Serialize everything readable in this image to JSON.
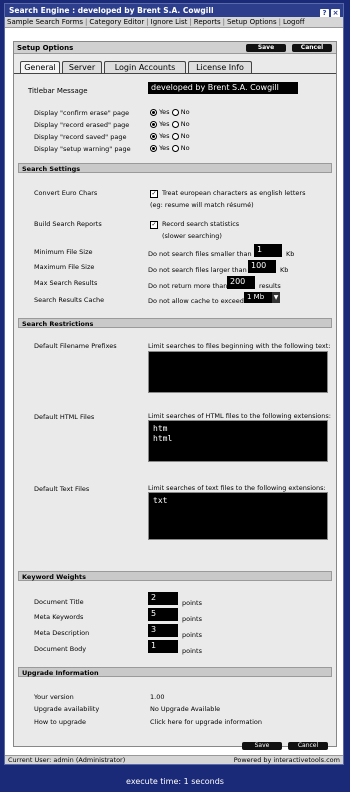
{
  "window": {
    "title": "Search Engine : developed by Brent S.A. Cowgill"
  },
  "menu": [
    "Sample Search Forms",
    "Category Editor",
    "Ignore List",
    "Reports",
    "Setup Options",
    "Logoff"
  ],
  "panel": {
    "title": "Setup Options",
    "save": "Save",
    "cancel": "Cancel"
  },
  "tabs": [
    "General",
    "Server",
    "Login Accounts",
    "License Info"
  ],
  "general": {
    "titlebar_label": "Titlebar Message",
    "titlebar_value": "developed by Brent S.A. Cowgill",
    "displays": [
      {
        "label": "Display \"confirm erase\" page",
        "value": "Yes"
      },
      {
        "label": "Display \"record erased\" page",
        "value": "Yes"
      },
      {
        "label": "Display \"record saved\" page",
        "value": "Yes"
      },
      {
        "label": "Display \"setup warning\" page",
        "value": "Yes"
      }
    ],
    "yes": "Yes",
    "no": "No"
  },
  "search_settings": {
    "heading": "Search Settings",
    "euro_label": "Convert Euro Chars",
    "euro_text1": "Treat european characters as english letters",
    "euro_text2": "(eg: resume will match résumé)",
    "build_label": "Build Search Reports",
    "build_text1": "Record search statistics",
    "build_text2": "(slower searching)",
    "min_label": "Minimum File Size",
    "min_text": "Do not search files smaller than",
    "min_value": "1",
    "min_unit": "Kb",
    "max_label": "Maximum File Size",
    "max_text": "Do not search files larger than",
    "max_value": "100",
    "max_unit": "Kb",
    "results_label": "Max Search Results",
    "results_text": "Do not return more than",
    "results_value": "200",
    "results_unit": "results",
    "cache_label": "Search Results Cache",
    "cache_text": "Do not allow cache to exceed",
    "cache_value": "1 Mb"
  },
  "search_restrictions": {
    "heading": "Search Restrictions",
    "prefix_label": "Default Filename Prefixes",
    "prefix_text": "Limit searches to files beginning with the following text:",
    "prefix_value": "",
    "html_label": "Default HTML Files",
    "html_text": "Limit searches of HTML files to the following extensions:",
    "html_value": "htm\nhtml",
    "text_label": "Default Text Files",
    "text_text": "Limit searches of text files to the following extensions:",
    "text_value": "txt"
  },
  "keyword_weights": {
    "heading": "Keyword Weights",
    "items": [
      {
        "label": "Document Title",
        "value": "2"
      },
      {
        "label": "Meta Keywords",
        "value": "5"
      },
      {
        "label": "Meta Description",
        "value": "3"
      },
      {
        "label": "Document Body",
        "value": "1"
      }
    ],
    "unit": "points"
  },
  "upgrade": {
    "heading": "Upgrade Information",
    "version_label": "Your version",
    "version_value": "1.00",
    "avail_label": "Upgrade availability",
    "avail_value": "No Upgrade Available",
    "how_label": "How to upgrade",
    "how_value": "Click here for upgrade information"
  },
  "status": {
    "left": "Current User: admin (Administrator)",
    "right": "Powered by interactivetools.com"
  },
  "footer": {
    "exec": "execute time: 1 seconds"
  }
}
